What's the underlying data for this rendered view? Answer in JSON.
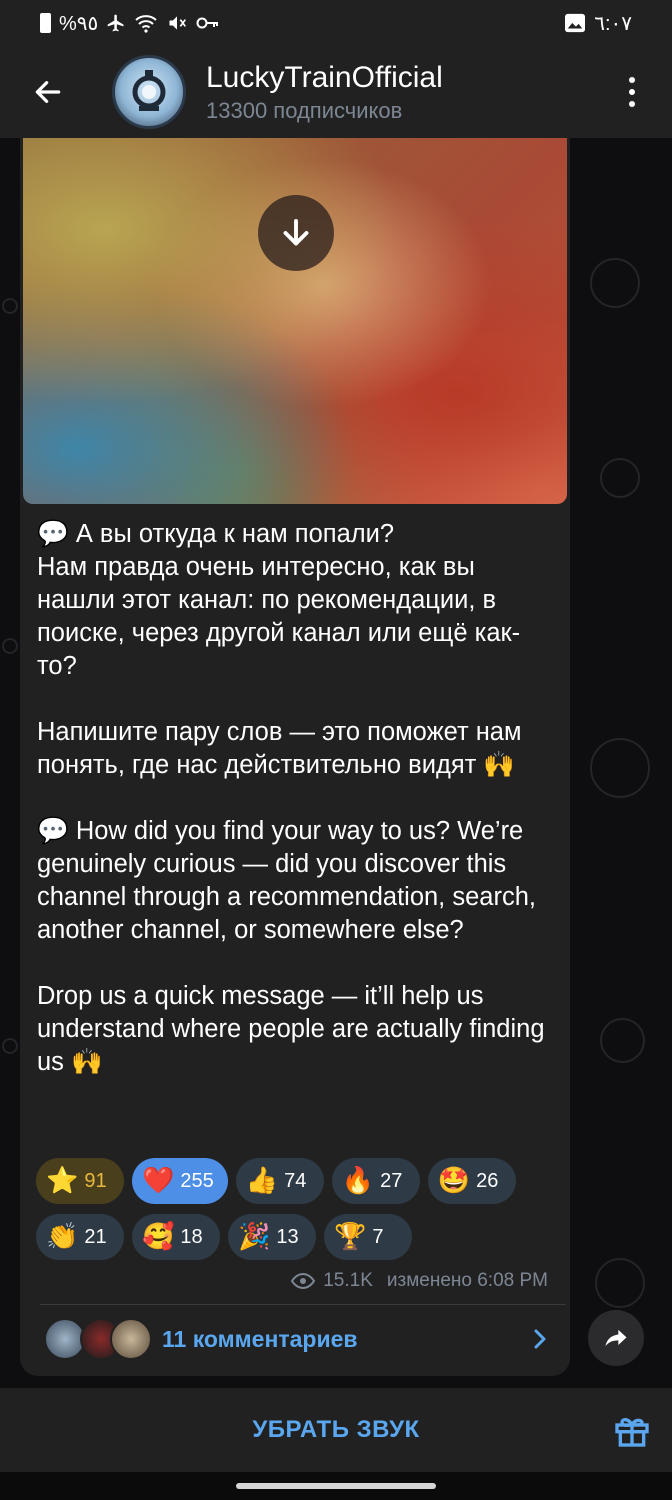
{
  "status_bar": {
    "battery": "%٩٥",
    "time": "٦:٠٧"
  },
  "header": {
    "channel_name": "LuckyTrainOfficial",
    "subscribers": "13300 подписчиков"
  },
  "message": {
    "text": "💬 А вы откуда к нам попали?\nНам правда очень интересно, как вы нашли этот канал: по рекомендации, в поиске, через другой канал или ещё как-то?\n\nНапишите пару слов — это поможет нам понять, где нас действительно видят 🙌\n\n💬 How did you find your way to us? We’re genuinely curious — did you discover this channel through a recommendation, search, another channel, or somewhere else?\n\nDrop us a quick message — it’ll help us understand where people are actually finding us 🙌",
    "views": "15.1K",
    "edited_time": "изменено 6:08 PM"
  },
  "reactions": [
    {
      "emoji": "⭐",
      "count": "91",
      "style": "gold"
    },
    {
      "emoji": "❤️",
      "count": "255",
      "style": "active"
    },
    {
      "emoji": "👍",
      "count": "74",
      "style": "normal"
    },
    {
      "emoji": "🔥",
      "count": "27",
      "style": "normal"
    },
    {
      "emoji": "🤩",
      "count": "26",
      "style": "normal"
    },
    {
      "emoji": "👏",
      "count": "21",
      "style": "normal"
    },
    {
      "emoji": "🥰",
      "count": "18",
      "style": "normal"
    },
    {
      "emoji": "🎉",
      "count": "13",
      "style": "normal"
    },
    {
      "emoji": "🏆",
      "count": "7",
      "style": "normal"
    }
  ],
  "comments": {
    "label": "11 комментариев"
  },
  "bottom_bar": {
    "mute_label": "УБРАТЬ ЗВУК"
  },
  "colors": {
    "accent": "#5aa7f0",
    "bubble": "#212121",
    "header": "#212121",
    "reaction_active": "#4d8ee6"
  }
}
